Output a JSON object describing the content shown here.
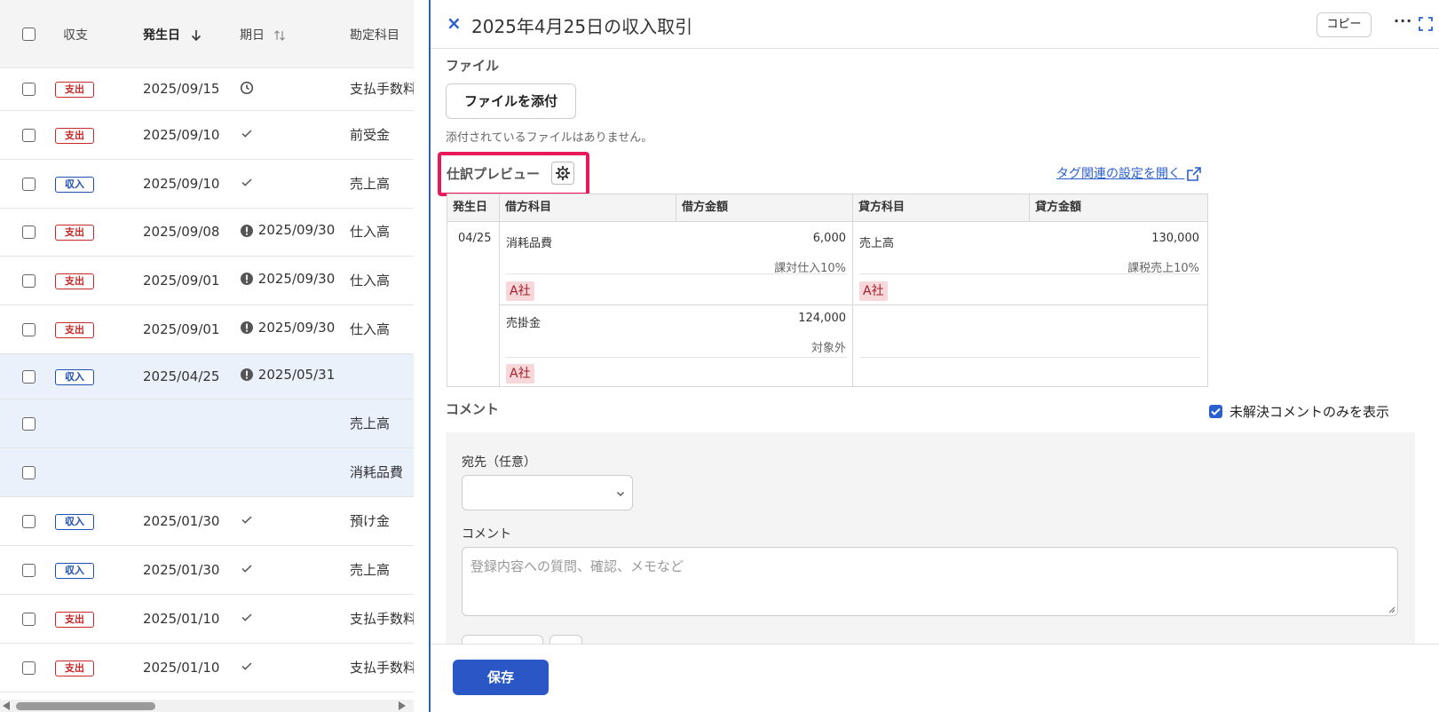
{
  "list": {
    "header": {
      "type": "収支",
      "occurrence_date": "発生日",
      "due_date": "期日",
      "account": "勘定科目"
    },
    "rows": [
      {
        "type": "支出",
        "kind": "out",
        "date": "2025/09/15",
        "due": "",
        "due_status": "clock",
        "account": "支払手数料"
      },
      {
        "type": "支出",
        "kind": "out",
        "date": "2025/09/10",
        "due": "",
        "due_status": "check",
        "account": "前受金"
      },
      {
        "type": "収入",
        "kind": "in",
        "date": "2025/09/10",
        "due": "",
        "due_status": "check",
        "account": "売上高"
      },
      {
        "type": "支出",
        "kind": "out",
        "date": "2025/09/08",
        "due": "2025/09/30",
        "due_status": "alert",
        "account": "仕入高"
      },
      {
        "type": "支出",
        "kind": "out",
        "date": "2025/09/01",
        "due": "2025/09/30",
        "due_status": "alert",
        "account": "仕入高"
      },
      {
        "type": "支出",
        "kind": "out",
        "date": "2025/09/01",
        "due": "2025/09/30",
        "due_status": "alert",
        "account": "仕入高"
      },
      {
        "type": "収入",
        "kind": "in",
        "date": "2025/04/25",
        "due": "2025/05/31",
        "due_status": "alert",
        "account": ""
      },
      {
        "type": "",
        "kind": "",
        "date": "",
        "due": "",
        "due_status": "",
        "account": "売上高"
      },
      {
        "type": "",
        "kind": "",
        "date": "",
        "due": "",
        "due_status": "",
        "account": "消耗品費"
      },
      {
        "type": "収入",
        "kind": "in",
        "date": "2025/01/30",
        "due": "",
        "due_status": "check",
        "account": "預け金"
      },
      {
        "type": "収入",
        "kind": "in",
        "date": "2025/01/30",
        "due": "",
        "due_status": "check",
        "account": "売上高"
      },
      {
        "type": "支出",
        "kind": "out",
        "date": "2025/01/10",
        "due": "",
        "due_status": "check",
        "account": "支払手数料"
      },
      {
        "type": "支出",
        "kind": "out",
        "date": "2025/01/10",
        "due": "",
        "due_status": "check",
        "account": "支払手数料"
      }
    ]
  },
  "panel": {
    "title": "2025年4月25日の収入取引",
    "copy_label": "コピー",
    "files": {
      "heading": "ファイル",
      "attach_label": "ファイルを添付",
      "empty_text": "添付されているファイルはありません。"
    },
    "journal": {
      "heading": "仕訳プレビュー",
      "tag_link": "タグ関連の設定を開く",
      "columns": {
        "date": "発生日",
        "debit_account": "借方科目",
        "debit_amount": "借方金額",
        "credit_account": "貸方科目",
        "credit_amount": "貸方金額"
      },
      "date": "04/25",
      "debit1": {
        "account": "消耗品費",
        "amount": "6,000",
        "tax": "課対仕入10%",
        "tag": "A社"
      },
      "credit1": {
        "account": "売上高",
        "amount": "130,000",
        "tax": "課税売上10%",
        "tag": "A社"
      },
      "debit2": {
        "account": "売掛金",
        "amount": "124,000",
        "tax": "対象外",
        "tag": "A社"
      }
    },
    "comment": {
      "heading": "コメント",
      "unresolved_only_label": "未解決コメントのみを表示",
      "unresolved_only_checked": true,
      "recipient_label": "宛先（任意）",
      "recipient_value": "",
      "comment_label": "コメント",
      "comment_placeholder": "登録内容への質問、確認、メモなど"
    },
    "save_label": "保存"
  },
  "colors": {
    "accent": "#2a56c6",
    "expense": "#c62828",
    "income": "#1f4fb0",
    "highlight": "#e8185a",
    "tag_bg": "#f8d7da"
  }
}
